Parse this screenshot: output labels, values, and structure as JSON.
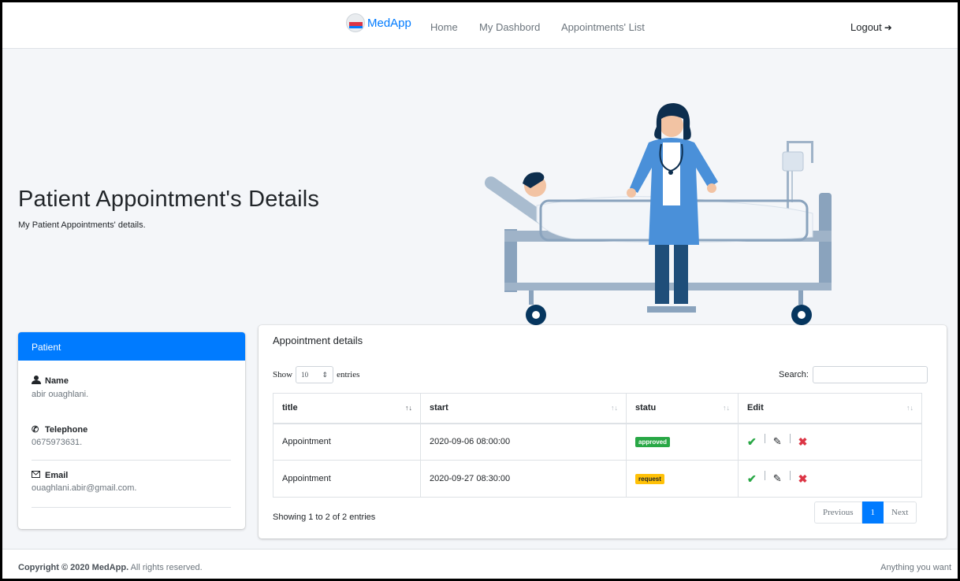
{
  "nav": {
    "brand": "MedApp",
    "links": [
      "Home",
      "My Dashbord",
      "Appointments' List"
    ],
    "logout": "Logout",
    "logout_icon": "sign-out-icon"
  },
  "hero": {
    "title": "Patient Appointment's Details",
    "subtitle": "My Patient Appointments' details."
  },
  "patient": {
    "header": "Patient",
    "name_label": "Name",
    "name_value": "abir ouaghlani.",
    "telephone_label": "Telephone",
    "telephone_value": "0675973631.",
    "email_label": "Email",
    "email_value": "ouaghlani.abir@gmail.com."
  },
  "appointments": {
    "title": "Appointment details",
    "show_prefix": "Show",
    "length_value": "10",
    "show_suffix": "entries",
    "search_label": "Search:",
    "columns": [
      "title",
      "start",
      "statu",
      "Edit"
    ],
    "rows": [
      {
        "title": "Appointment",
        "start": "2020-09-06 08:00:00",
        "statu": "approved"
      },
      {
        "title": "Appointment",
        "start": "2020-09-27 08:30:00",
        "statu": "request"
      }
    ],
    "showing": "Showing 1 to 2 of 2 entries",
    "pagination": {
      "previous": "Previous",
      "current": "1",
      "next": "Next"
    }
  },
  "footer": {
    "copyright_bold": "Copyright © 2020 MedApp.",
    "copyright_rest": " All rights reserved.",
    "right": "Anything you want"
  },
  "colors": {
    "primary": "#007bff",
    "success": "#28a745",
    "warning": "#ffc107",
    "danger": "#dc3545"
  }
}
